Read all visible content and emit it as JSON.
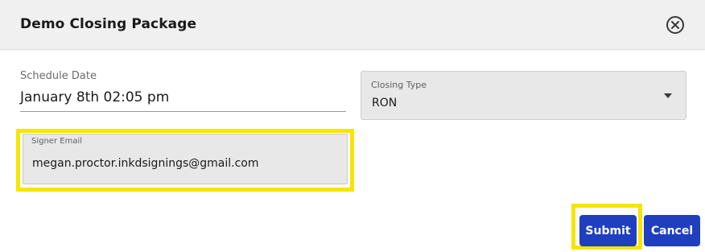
{
  "dialog": {
    "title": "Demo Closing Package"
  },
  "form": {
    "schedule_date": {
      "label": "Schedule Date",
      "value": "January 8th 02:05 pm"
    },
    "closing_type": {
      "label": "Closing Type",
      "value": "RON"
    },
    "signer_email": {
      "label": "Signer Email",
      "value": "megan.proctor.inkdsignings@gmail.com"
    }
  },
  "actions": {
    "submit_label": "Submit",
    "cancel_label": "Cancel"
  },
  "icons": {
    "close": "close-circle-icon",
    "dropdown": "caret-down-icon"
  },
  "colors": {
    "primary_button": "#1f3fbf",
    "highlight": "#f8e400",
    "header_bg": "#f0f0f0",
    "field_bg": "#e8e8e8"
  }
}
